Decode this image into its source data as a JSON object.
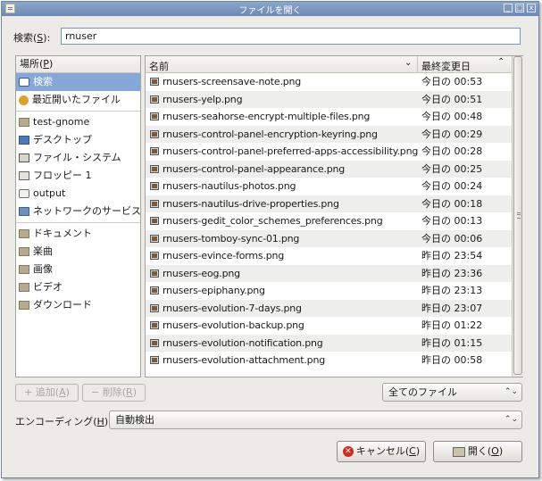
{
  "window": {
    "title": "ファイルを開く",
    "btn_min": "_",
    "btn_max": "□",
    "btn_close": "x"
  },
  "search": {
    "label_main": "検索(",
    "label_key": "S",
    "label_tail": "):",
    "value": "rnuser"
  },
  "places": {
    "header": {
      "main": "場所(",
      "key": "P",
      "tail": ")"
    },
    "items": [
      {
        "label": "検索",
        "icon": "search-icon"
      },
      {
        "label": "最近開いたファイル",
        "icon": "recent-icon"
      },
      {
        "label": "test-gnome",
        "icon": "folder-icon"
      },
      {
        "label": "デスクトップ",
        "icon": "desktop-icon"
      },
      {
        "label": "ファイル・システム",
        "icon": "filesystem-icon"
      },
      {
        "label": "フロッピー 1",
        "icon": "floppy-icon"
      },
      {
        "label": "output",
        "icon": "drive-icon"
      },
      {
        "label": "ネットワークのサービス",
        "icon": "network-icon"
      },
      {
        "label": "ドキュメント",
        "icon": "folder-icon"
      },
      {
        "label": "楽曲",
        "icon": "folder-icon"
      },
      {
        "label": "画像",
        "icon": "folder-icon"
      },
      {
        "label": "ビデオ",
        "icon": "folder-icon"
      },
      {
        "label": "ダウンロード",
        "icon": "folder-icon"
      }
    ]
  },
  "files": {
    "col_name": "名前",
    "col_date": "最終変更日",
    "sort_glyph": "⌄",
    "sort_dir_glyph": "⌃",
    "rows": [
      {
        "name": "rnusers-screensave-note.png",
        "date": "今日の 00:53"
      },
      {
        "name": "rnusers-yelp.png",
        "date": "今日の 00:51"
      },
      {
        "name": "rnusers-seahorse-encrypt-multiple-files.png",
        "date": "今日の 00:48"
      },
      {
        "name": "rnusers-control-panel-encryption-keyring.png",
        "date": "今日の 00:29"
      },
      {
        "name": "rnusers-control-panel-preferred-apps-accessibility.png",
        "date": "今日の 00:28"
      },
      {
        "name": "rnusers-control-panel-appearance.png",
        "date": "今日の 00:25"
      },
      {
        "name": "rnusers-nautilus-photos.png",
        "date": "今日の 00:24"
      },
      {
        "name": "rnusers-nautilus-drive-properties.png",
        "date": "今日の 00:18"
      },
      {
        "name": "rnusers-gedit_color_schemes_preferences.png",
        "date": "今日の 00:13"
      },
      {
        "name": "rnusers-tomboy-sync-01.png",
        "date": "今日の 00:06"
      },
      {
        "name": "rnusers-evince-forms.png",
        "date": "昨日の 23:54"
      },
      {
        "name": "rnusers-eog.png",
        "date": "昨日の 23:36"
      },
      {
        "name": "rnusers-epiphany.png",
        "date": "昨日の 23:13"
      },
      {
        "name": "rnusers-evolution-7-days.png",
        "date": "昨日の 23:07"
      },
      {
        "name": "rnusers-evolution-backup.png",
        "date": "昨日の 01:22"
      },
      {
        "name": "rnusers-evolution-notification.png",
        "date": "昨日の 01:15"
      },
      {
        "name": "rnusers-evolution-attachment.png",
        "date": "昨日の 00:58"
      }
    ]
  },
  "bottom": {
    "add": {
      "glyph": "+",
      "main": "追加(",
      "key": "A",
      "tail": ")"
    },
    "remove": {
      "glyph": "−",
      "main": "削除(",
      "key": "R",
      "tail": ")"
    },
    "filter": {
      "value": "全てのファイル",
      "arrows": "⌃⌄"
    },
    "encoding": {
      "label_main": "エンコーディング(",
      "label_key": "H",
      "label_tail": "):",
      "value": "自動検出",
      "arrows": "⌃⌄"
    },
    "cancel": {
      "glyph": "✕",
      "main": "キャンセル(",
      "key": "C",
      "tail": ")"
    },
    "open": {
      "main": "開く(",
      "key": "O",
      "tail": ")"
    }
  }
}
